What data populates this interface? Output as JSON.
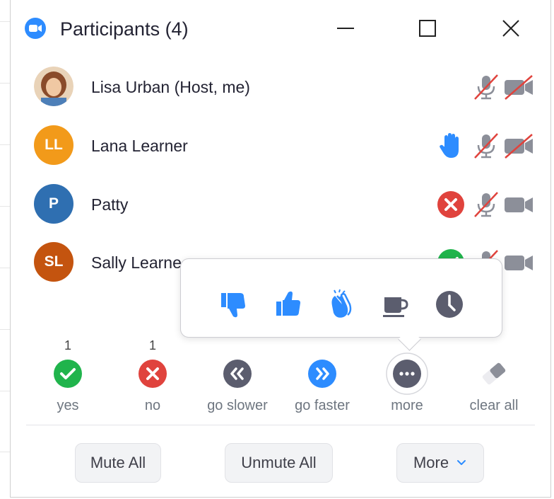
{
  "window": {
    "title": "Participants (4)"
  },
  "participants": [
    {
      "name": "Lisa Urban (Host, me)",
      "initials": "",
      "avatar_color": "#d9a46c",
      "status": "none",
      "audio": "muted",
      "video": "off"
    },
    {
      "name": "Lana Learner",
      "initials": "LL",
      "avatar_color": "#f29a1a",
      "status": "raised-hand",
      "audio": "muted",
      "video": "off"
    },
    {
      "name": "Patty",
      "initials": "P",
      "avatar_color": "#2f6fb1",
      "status": "no",
      "audio": "muted",
      "video": "on"
    },
    {
      "name": "Sally Learne",
      "initials": "SL",
      "avatar_color": "#c4540f",
      "status": "yes",
      "audio": "muted",
      "video": "on"
    }
  ],
  "reaction_popup": {
    "icons": [
      "thumbs-down-icon",
      "thumbs-up-icon",
      "clap-icon",
      "coffee-icon",
      "clock-icon"
    ]
  },
  "feedback": [
    {
      "count": "1",
      "label": "yes",
      "icon": "check-icon",
      "color": "#20b44c"
    },
    {
      "count": "1",
      "label": "no",
      "icon": "x-icon",
      "color": "#e0433d"
    },
    {
      "count": "",
      "label": "go slower",
      "icon": "rewind-icon",
      "color": "#5b5d6e"
    },
    {
      "count": "",
      "label": "go faster",
      "icon": "fast-forward-icon",
      "color": "#2d8cff"
    },
    {
      "count": "",
      "label": "more",
      "icon": "more-icon",
      "color": "#5b5d6e"
    },
    {
      "count": "",
      "label": "clear all",
      "icon": "eraser-icon",
      "color": "#9a9aa6"
    }
  ],
  "buttons": {
    "mute_all": "Mute All",
    "unmute_all": "Unmute All",
    "more": "More"
  },
  "colors": {
    "accent": "#2d8cff",
    "muted_red": "#e0433d",
    "icon_gray": "#6e7680"
  }
}
